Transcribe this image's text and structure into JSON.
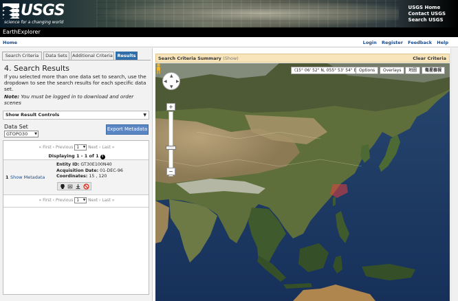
{
  "header": {
    "logo_text": "USGS",
    "tagline": "science for a changing world",
    "links": [
      "USGS Home",
      "Contact USGS",
      "Search USGS"
    ]
  },
  "app": {
    "title": "EarthExplorer"
  },
  "nav": {
    "home": "Home",
    "right_links": [
      "Login",
      "Register",
      "Feedback",
      "Help"
    ]
  },
  "tabs": [
    {
      "label": "Search Criteria",
      "active": false
    },
    {
      "label": "Data Sets",
      "active": false
    },
    {
      "label": "Additional Criteria",
      "active": false
    },
    {
      "label": "Results",
      "active": true
    }
  ],
  "results": {
    "title": "4. Search Results",
    "description": "If you selected more than one data set to search, use the dropdown to see the search results for each specific data set.",
    "note_label": "Note:",
    "note_text": " You must be logged in to download and order scenes",
    "show_controls": "Show Result Controls",
    "dataset_label": "Data Set",
    "dataset_value": "GTOPO30",
    "export_label": "Export Metadata",
    "pager": {
      "first": "« First",
      "previous": "‹ Previous",
      "page": "1",
      "next": "Next ›",
      "last": "Last »"
    },
    "displaying": "Displaying 1 - 1 of 1",
    "row": {
      "number": "1",
      "show_metadata": "Show Metadata",
      "entity_label": "Entity ID:",
      "entity_value": "GT30E100N40",
      "acq_label": "Acquisition Date:",
      "acq_value": "01-DEC-96",
      "coord_label": "Coordinates:",
      "coord_value": "15 , 120"
    }
  },
  "map": {
    "summary_title": "Search Criteria Summary",
    "summary_show": "(Show)",
    "clear": "Clear Criteria",
    "coords": "(15° 06' 52\" N, 055° 53' 54\" E)",
    "options": "Options",
    "overlays": "Overlays",
    "map_type": "地圖",
    "satellite_type": "衛星檢視",
    "colors": {
      "ocean": "#1e3b64",
      "land": "#5b6b3a",
      "desert": "#a08a5c",
      "highlight": "#e2403c"
    }
  }
}
